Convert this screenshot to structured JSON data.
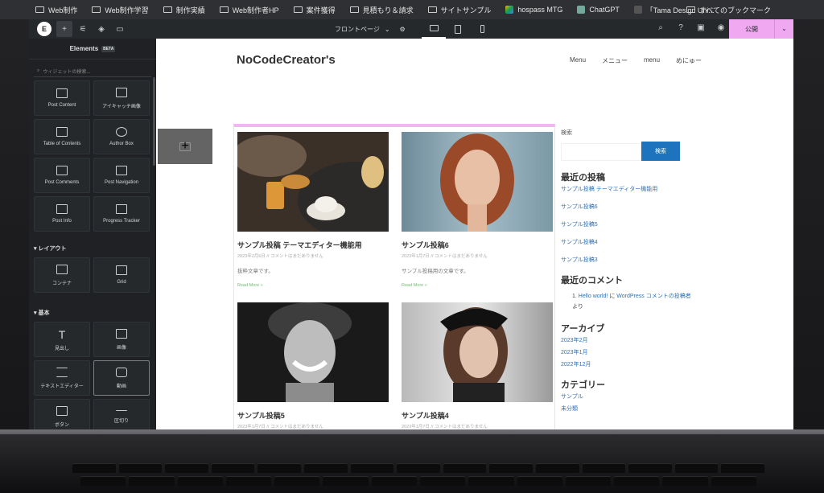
{
  "bookmarks": [
    "Web制作",
    "Web制作学習",
    "制作実績",
    "Web制作者HP",
    "案件獲得",
    "見積もり＆請求",
    "サイトサンプル",
    "hospass MTG",
    "ChatGPT",
    "「Tama Design Uni..."
  ],
  "bookmarks_all": "すべてのブックマーク",
  "topbar": {
    "page_label": "フロントページ",
    "publish_label": "公開"
  },
  "sidebar": {
    "title": "Elements",
    "beta": "BETA",
    "search_placeholder": "ウィジェットの検索...",
    "widgets_top": [
      "Post Content",
      "アイキャッチ画像",
      "Table of Contents",
      "Author Box",
      "Post Comments",
      "Post Navigation",
      "Post Info",
      "Progress Tracker"
    ],
    "section_layout": "レイアウト",
    "layout": [
      "コンテナ",
      "Grid"
    ],
    "section_basic": "基本",
    "basic": [
      "見出し",
      "画像",
      "テキストエディター",
      "動画",
      "ボタン",
      "区切り"
    ]
  },
  "site": {
    "title": "NoCodeCreator's",
    "menu": [
      "Menu",
      "メニュー",
      "menu",
      "めにゅー"
    ],
    "posts": [
      {
        "title": "サンプル投稿 テーマエディター機能用",
        "meta": "2023年2月6日 // コメントはまだありません",
        "excerpt": "抜粋文章です。",
        "more": "Read More »"
      },
      {
        "title": "サンプル投稿6",
        "meta": "2023年1月7日 // コメントはまだありません",
        "excerpt": "サンプル投稿用の文章です。",
        "more": "Read More »"
      },
      {
        "title": "サンプル投稿5",
        "meta": "2023年1月7日 // コメントはまだありません"
      },
      {
        "title": "サンプル投稿4",
        "meta": "2023年1月7日 // コメントはまだありません"
      }
    ],
    "sidebar": {
      "search_label": "検索",
      "search_button": "検索",
      "recent_posts_title": "最近の投稿",
      "recent_posts": [
        "サンプル投稿 テーマエディター機能用",
        "サンプル投稿6",
        "サンプル投稿5",
        "サンプル投稿4",
        "サンプル投稿3"
      ],
      "recent_comments_title": "最近のコメント",
      "comment_author": "Hello world!",
      "comment_on": " に ",
      "comment_post": "WordPress コメントの投稿者",
      "comment_tail": "より",
      "archives_title": "アーカイブ",
      "archives": [
        "2023年2月",
        "2023年1月",
        "2022年12月"
      ],
      "categories_title": "カテゴリー",
      "categories": [
        "サンプル",
        "未分類"
      ]
    }
  }
}
